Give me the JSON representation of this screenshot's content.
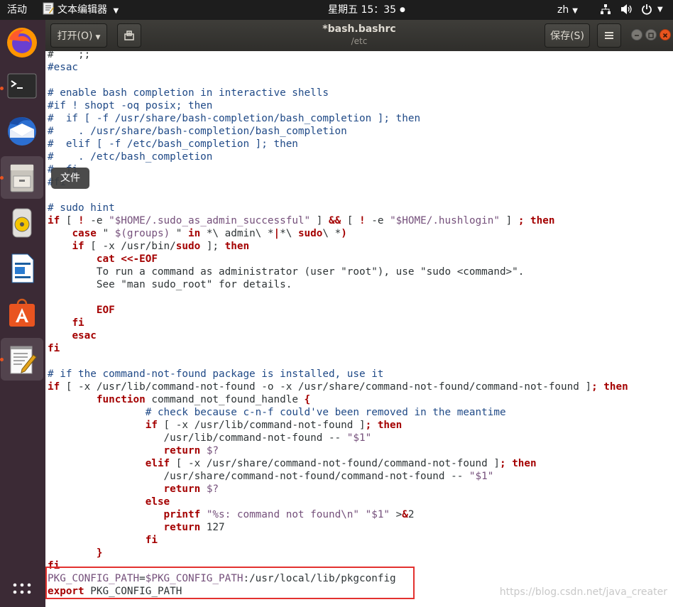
{
  "topbar": {
    "activities": "活动",
    "app_name": "文本编辑器",
    "clock": "星期五 15：35",
    "input_method": "zh"
  },
  "dock": {
    "tooltip": "文件",
    "items": [
      "firefox-icon",
      "terminal-icon",
      "thunderbird-icon",
      "files-icon",
      "rhythmbox-icon",
      "libreoffice-writer-icon",
      "ubuntu-software-icon",
      "text-editor-icon",
      "show-applications-icon"
    ]
  },
  "headerbar": {
    "open_label": "打开(O)",
    "title": "*bash.bashrc",
    "subtitle": "/etc",
    "save_label": "保存(S)"
  },
  "editor": {
    "lines": [
      [
        [
          "p",
          "#    ;;"
        ]
      ],
      [
        [
          "c",
          "#esac"
        ]
      ],
      [
        [
          "p",
          ""
        ]
      ],
      [
        [
          "c",
          "# enable bash completion in interactive shells"
        ]
      ],
      [
        [
          "c",
          "#if ! shopt -oq posix; then"
        ]
      ],
      [
        [
          "c",
          "#  if [ -f /usr/share/bash-completion/bash_completion ]; then"
        ]
      ],
      [
        [
          "c",
          "#    . /usr/share/bash-completion/bash_completion"
        ]
      ],
      [
        [
          "c",
          "#  elif [ -f /etc/bash_completion ]; then"
        ]
      ],
      [
        [
          "c",
          "#    . /etc/bash_completion"
        ]
      ],
      [
        [
          "c",
          "#  fi"
        ]
      ],
      [
        [
          "c",
          "#fi"
        ]
      ],
      [
        [
          "p",
          ""
        ]
      ],
      [
        [
          "c",
          "# sudo hint"
        ]
      ],
      [
        [
          "k",
          "if"
        ],
        [
          "p",
          " [ "
        ],
        [
          "k",
          "!"
        ],
        [
          "p",
          " -e "
        ],
        [
          "s",
          "\"$HOME/.sudo_as_admin_successful\""
        ],
        [
          "p",
          " ] "
        ],
        [
          "k",
          "&&"
        ],
        [
          "p",
          " [ "
        ],
        [
          "k",
          "!"
        ],
        [
          "p",
          " -e "
        ],
        [
          "s",
          "\"$HOME/.hushlogin\""
        ],
        [
          "p",
          " ] "
        ],
        [
          "k",
          ";"
        ],
        [
          "p",
          " "
        ],
        [
          "k",
          "then"
        ]
      ],
      [
        [
          "p",
          "    "
        ],
        [
          "k",
          "case"
        ],
        [
          "p",
          " \" "
        ],
        [
          "s",
          "$(groups)"
        ],
        [
          "p",
          " \" "
        ],
        [
          "k",
          "in"
        ],
        [
          "p",
          " *\\ admin\\ *"
        ],
        [
          "k",
          "|"
        ],
        [
          "p",
          "*\\ "
        ],
        [
          "k",
          "sudo"
        ],
        [
          "p",
          "\\ *"
        ],
        [
          "k",
          ")"
        ]
      ],
      [
        [
          "p",
          "    "
        ],
        [
          "k",
          "if"
        ],
        [
          "p",
          " [ -x /usr/bin/"
        ],
        [
          "k",
          "sudo"
        ],
        [
          "p",
          " ]; "
        ],
        [
          "k",
          "then"
        ]
      ],
      [
        [
          "p",
          "        "
        ],
        [
          "k",
          "cat <<-EOF"
        ]
      ],
      [
        [
          "p",
          "        To run a command as administrator (user \"root\"), use \"sudo <command>\"."
        ]
      ],
      [
        [
          "p",
          "        See \"man sudo_root\" for details."
        ]
      ],
      [
        [
          "p",
          ""
        ]
      ],
      [
        [
          "p",
          "        "
        ],
        [
          "k",
          "EOF"
        ]
      ],
      [
        [
          "p",
          "    "
        ],
        [
          "k",
          "fi"
        ]
      ],
      [
        [
          "p",
          "    "
        ],
        [
          "k",
          "esac"
        ]
      ],
      [
        [
          "k",
          "fi"
        ]
      ],
      [
        [
          "p",
          ""
        ]
      ],
      [
        [
          "c",
          "# if the command-not-found package is installed, use it"
        ]
      ],
      [
        [
          "k",
          "if"
        ],
        [
          "p",
          " [ -x /usr/lib/command-not-found -o -x /usr/share/command-not-found/command-not-found ]"
        ],
        [
          "k",
          "; then"
        ]
      ],
      [
        [
          "p",
          "        "
        ],
        [
          "k",
          "function"
        ],
        [
          "p",
          " command_not_found_handle "
        ],
        [
          "k",
          "{"
        ]
      ],
      [
        [
          "p",
          "                "
        ],
        [
          "c",
          "# check because c-n-f could've been removed in the meantime"
        ]
      ],
      [
        [
          "p",
          "                "
        ],
        [
          "k",
          "if"
        ],
        [
          "p",
          " [ -x /usr/lib/command-not-found ]"
        ],
        [
          "k",
          "; then"
        ]
      ],
      [
        [
          "p",
          "                   /usr/lib/command-not-found -- "
        ],
        [
          "s",
          "\"$1\""
        ]
      ],
      [
        [
          "p",
          "                   "
        ],
        [
          "k",
          "return"
        ],
        [
          "p",
          " "
        ],
        [
          "s",
          "$?"
        ]
      ],
      [
        [
          "p",
          "                "
        ],
        [
          "k",
          "elif"
        ],
        [
          "p",
          " [ -x /usr/share/command-not-found/command-not-found ]"
        ],
        [
          "k",
          "; then"
        ]
      ],
      [
        [
          "p",
          "                   /usr/share/command-not-found/command-not-found -- "
        ],
        [
          "s",
          "\"$1\""
        ]
      ],
      [
        [
          "p",
          "                   "
        ],
        [
          "k",
          "return"
        ],
        [
          "p",
          " "
        ],
        [
          "s",
          "$?"
        ]
      ],
      [
        [
          "p",
          "                "
        ],
        [
          "k",
          "else"
        ]
      ],
      [
        [
          "p",
          "                   "
        ],
        [
          "k",
          "printf"
        ],
        [
          "p",
          " "
        ],
        [
          "s",
          "\"%s: command not found\\n\""
        ],
        [
          "p",
          " "
        ],
        [
          "s",
          "\"$1\""
        ],
        [
          "p",
          " >"
        ],
        [
          "k",
          "&"
        ],
        [
          "p",
          "2"
        ]
      ],
      [
        [
          "p",
          "                   "
        ],
        [
          "k",
          "return"
        ],
        [
          "p",
          " 127"
        ]
      ],
      [
        [
          "p",
          "                "
        ],
        [
          "k",
          "fi"
        ]
      ],
      [
        [
          "p",
          "        "
        ],
        [
          "k",
          "}"
        ]
      ],
      [
        [
          "k",
          "fi"
        ]
      ],
      [
        [
          "v",
          "PKG_CONFIG_PATH"
        ],
        [
          "p",
          "="
        ],
        [
          "v",
          "$PKG_CONFIG_PATH"
        ],
        [
          "p",
          ":/usr/local/lib/pkgconfig"
        ]
      ],
      [
        [
          "k",
          "export"
        ],
        [
          "p",
          " PKG_CONFIG_PATH"
        ]
      ],
      [
        [
          "p",
          ""
        ]
      ]
    ]
  },
  "watermark": "https://blog.csdn.net/java_creater"
}
